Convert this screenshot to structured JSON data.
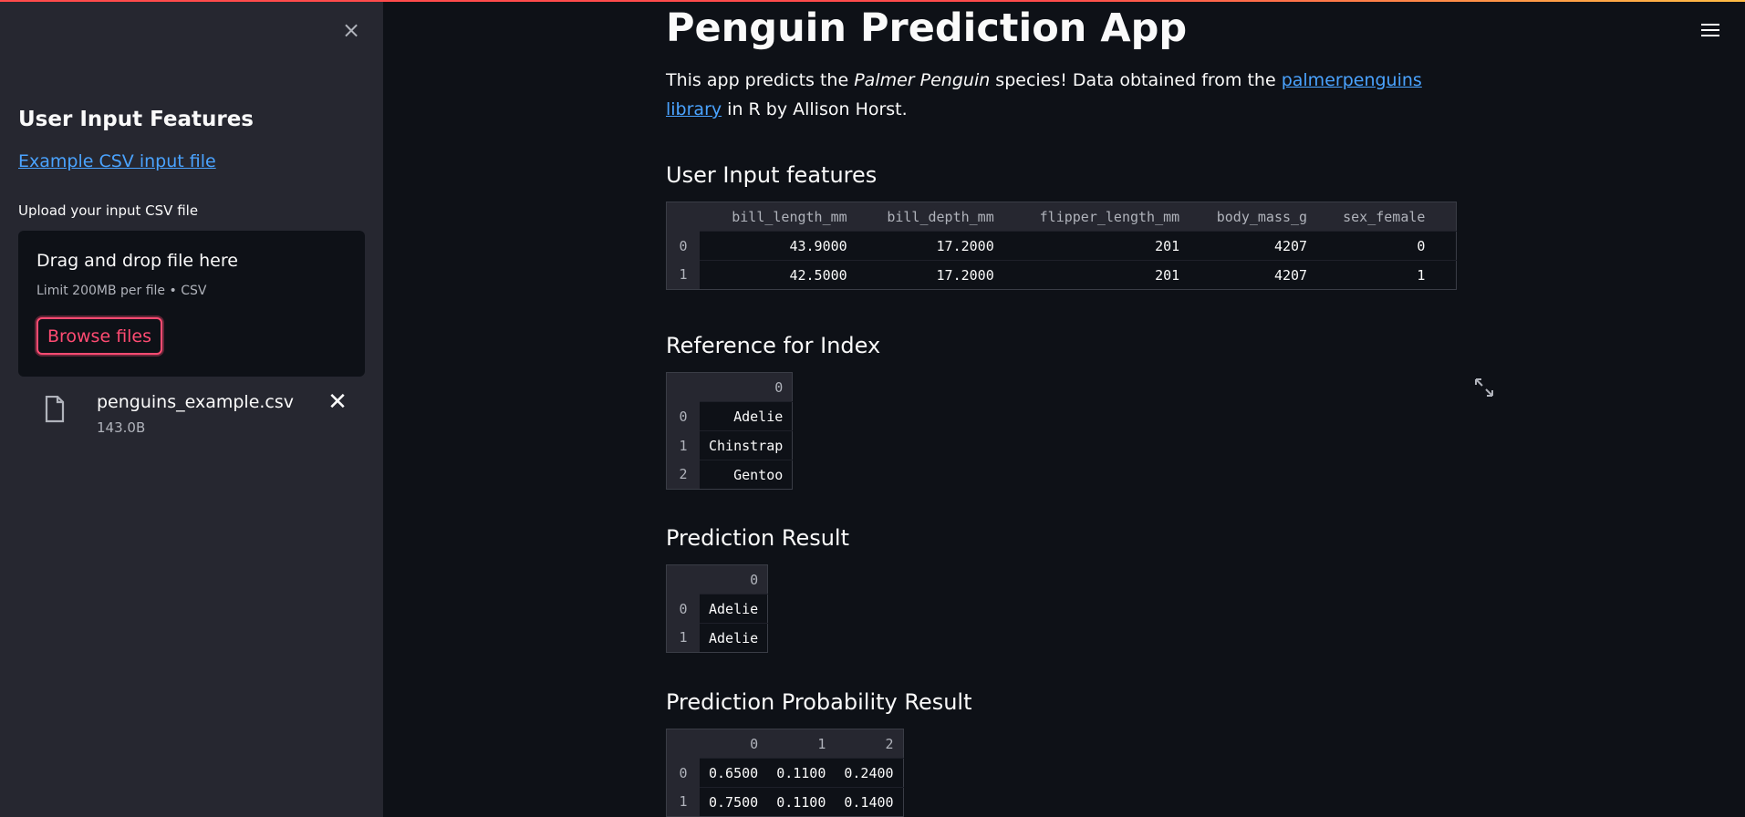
{
  "sidebar": {
    "close_glyph": "×",
    "title": "User Input Features",
    "example_link": "Example CSV input file",
    "upload_label": "Upload your input CSV file",
    "dropzone": {
      "title": "Drag and drop file here",
      "subtitle": "Limit 200MB per file • CSV",
      "browse_label": "Browse files"
    },
    "file": {
      "name": "penguins_example.csv",
      "size": "143.0B",
      "remove_glyph": "✕"
    }
  },
  "main": {
    "title": "Penguin Prediction App",
    "intro": {
      "before": "This app predicts the ",
      "em": "Palmer Penguin",
      "middle": " species! Data obtained from the ",
      "link": "palmerpenguins library",
      "after": " in R by Allison Horst."
    },
    "sections": {
      "input_features": "User Input features",
      "reference": "Reference for Index",
      "prediction": "Prediction Result",
      "probability": "Prediction Probability Result"
    },
    "input_table": {
      "columns": [
        "bill_length_mm",
        "bill_depth_mm",
        "flipper_length_mm",
        "body_mass_g",
        "sex_female",
        ""
      ],
      "rows": [
        {
          "index": "0",
          "cells": [
            "43.9000",
            "17.2000",
            "201",
            "4207",
            "0",
            ""
          ]
        },
        {
          "index": "1",
          "cells": [
            "42.5000",
            "17.2000",
            "201",
            "4207",
            "1",
            ""
          ]
        }
      ]
    },
    "reference_table": {
      "columns": [
        "0"
      ],
      "rows": [
        {
          "index": "0",
          "cells": [
            "Adelie"
          ]
        },
        {
          "index": "1",
          "cells": [
            "Chinstrap"
          ]
        },
        {
          "index": "2",
          "cells": [
            "Gentoo"
          ]
        }
      ]
    },
    "prediction_table": {
      "columns": [
        "0"
      ],
      "rows": [
        {
          "index": "0",
          "cells": [
            "Adelie"
          ]
        },
        {
          "index": "1",
          "cells": [
            "Adelie"
          ]
        }
      ]
    },
    "probability_table": {
      "columns": [
        "0",
        "1",
        "2"
      ],
      "rows": [
        {
          "index": "0",
          "cells": [
            "0.6500",
            "0.1100",
            "0.2400"
          ]
        },
        {
          "index": "1",
          "cells": [
            "0.7500",
            "0.1100",
            "0.1400"
          ]
        }
      ]
    }
  },
  "icons": {
    "close": "close-icon",
    "file": "file-icon",
    "remove": "close-icon",
    "menu": "hamburger-menu-icon",
    "expand": "fullscreen-expand-icon"
  },
  "colors": {
    "background": "#0e1117",
    "sidebar": "#262730",
    "accent": "#ff4b72",
    "link": "#4aa3ff"
  }
}
